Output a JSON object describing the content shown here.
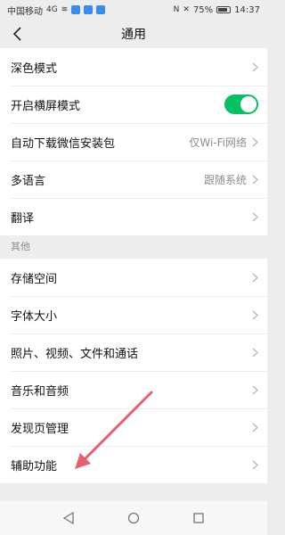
{
  "status_bar": {
    "carrier": "中国移动",
    "signal": "4G",
    "battery": "75%",
    "time": "14:37"
  },
  "nav": {
    "title": "通用"
  },
  "settings_group_1": [
    {
      "label": "深色模式",
      "value": ""
    },
    {
      "label": "开启横屏模式",
      "toggle": true
    },
    {
      "label": "自动下载微信安装包",
      "value": "仅Wi-Fi网络"
    },
    {
      "label": "多语言",
      "value": "跟随系统"
    },
    {
      "label": "翻译",
      "value": ""
    }
  ],
  "section_other_label": "其他",
  "settings_group_2": [
    {
      "label": "存储空间"
    },
    {
      "label": "字体大小"
    },
    {
      "label": "照片、视频、文件和通话"
    },
    {
      "label": "音乐和音频"
    },
    {
      "label": "发现页管理"
    },
    {
      "label": "辅助功能"
    }
  ],
  "colors": {
    "toggle_on": "#07c160",
    "annotation_arrow": "#e8606e"
  },
  "icons": {
    "back": "chevron-left-icon",
    "row_arrow": "chevron-right-icon",
    "nav_back": "triangle-back-icon",
    "nav_home": "circle-home-icon",
    "nav_recent": "square-recent-icon"
  }
}
